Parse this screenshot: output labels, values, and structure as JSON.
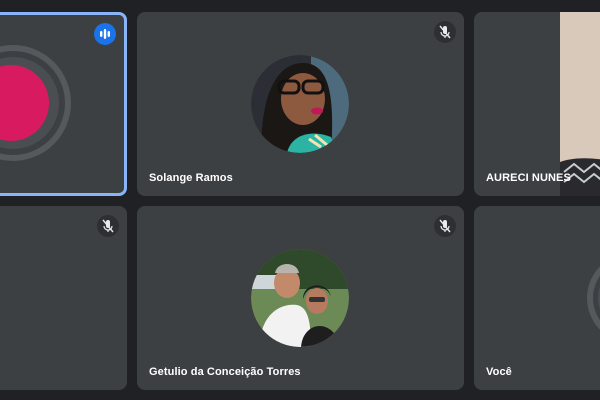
{
  "participants": [
    {
      "name": "",
      "speaking": true
    },
    {
      "name": "Solange Ramos",
      "muted": true
    },
    {
      "name": "AURECI NUNES",
      "muted": false
    },
    {
      "name": "",
      "muted": true
    },
    {
      "name": "Getulio da Conceição Torres",
      "muted": true
    },
    {
      "name": "Você",
      "muted": false
    }
  ],
  "colors": {
    "background": "#202124",
    "tile": "#3c4043",
    "active_border": "#8ab4f8",
    "speaking_badge": "#1a73e8"
  },
  "icons": {
    "muted": "mic-off-icon",
    "speaking": "audio-level-icon"
  }
}
